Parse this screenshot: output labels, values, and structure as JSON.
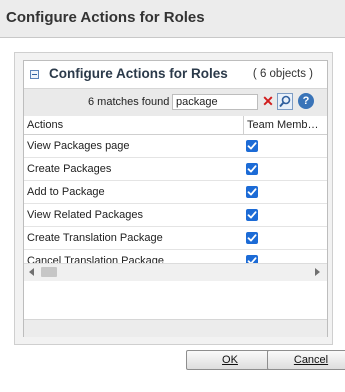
{
  "window": {
    "title": "Configure Actions for Roles"
  },
  "group": {
    "title": "Configure Actions for Roles",
    "count": "( 6 objects )",
    "collapse_icon": "minus-square-icon"
  },
  "search": {
    "matches_text": "6 matches found",
    "value": "package",
    "clear_icon": "red-x-icon",
    "search_icon": "magnifier-icon",
    "help_icon": "question-mark-icon"
  },
  "table": {
    "columns": [
      "Actions",
      "Team Memb…"
    ],
    "rows": [
      {
        "action": "View Packages page",
        "team_member": true
      },
      {
        "action": "Create Packages",
        "team_member": true
      },
      {
        "action": "Add to Package",
        "team_member": true
      },
      {
        "action": "View Related Packages",
        "team_member": true
      },
      {
        "action": "Create Translation Package",
        "team_member": true
      },
      {
        "action": "Cancel Translation Package",
        "team_member": true
      }
    ]
  },
  "buttons": {
    "ok": "OK",
    "cancel": "Cancel"
  },
  "colors": {
    "checkbox": "#1c6bd6",
    "accent": "#3a74b8",
    "clear": "#d11d1d"
  }
}
